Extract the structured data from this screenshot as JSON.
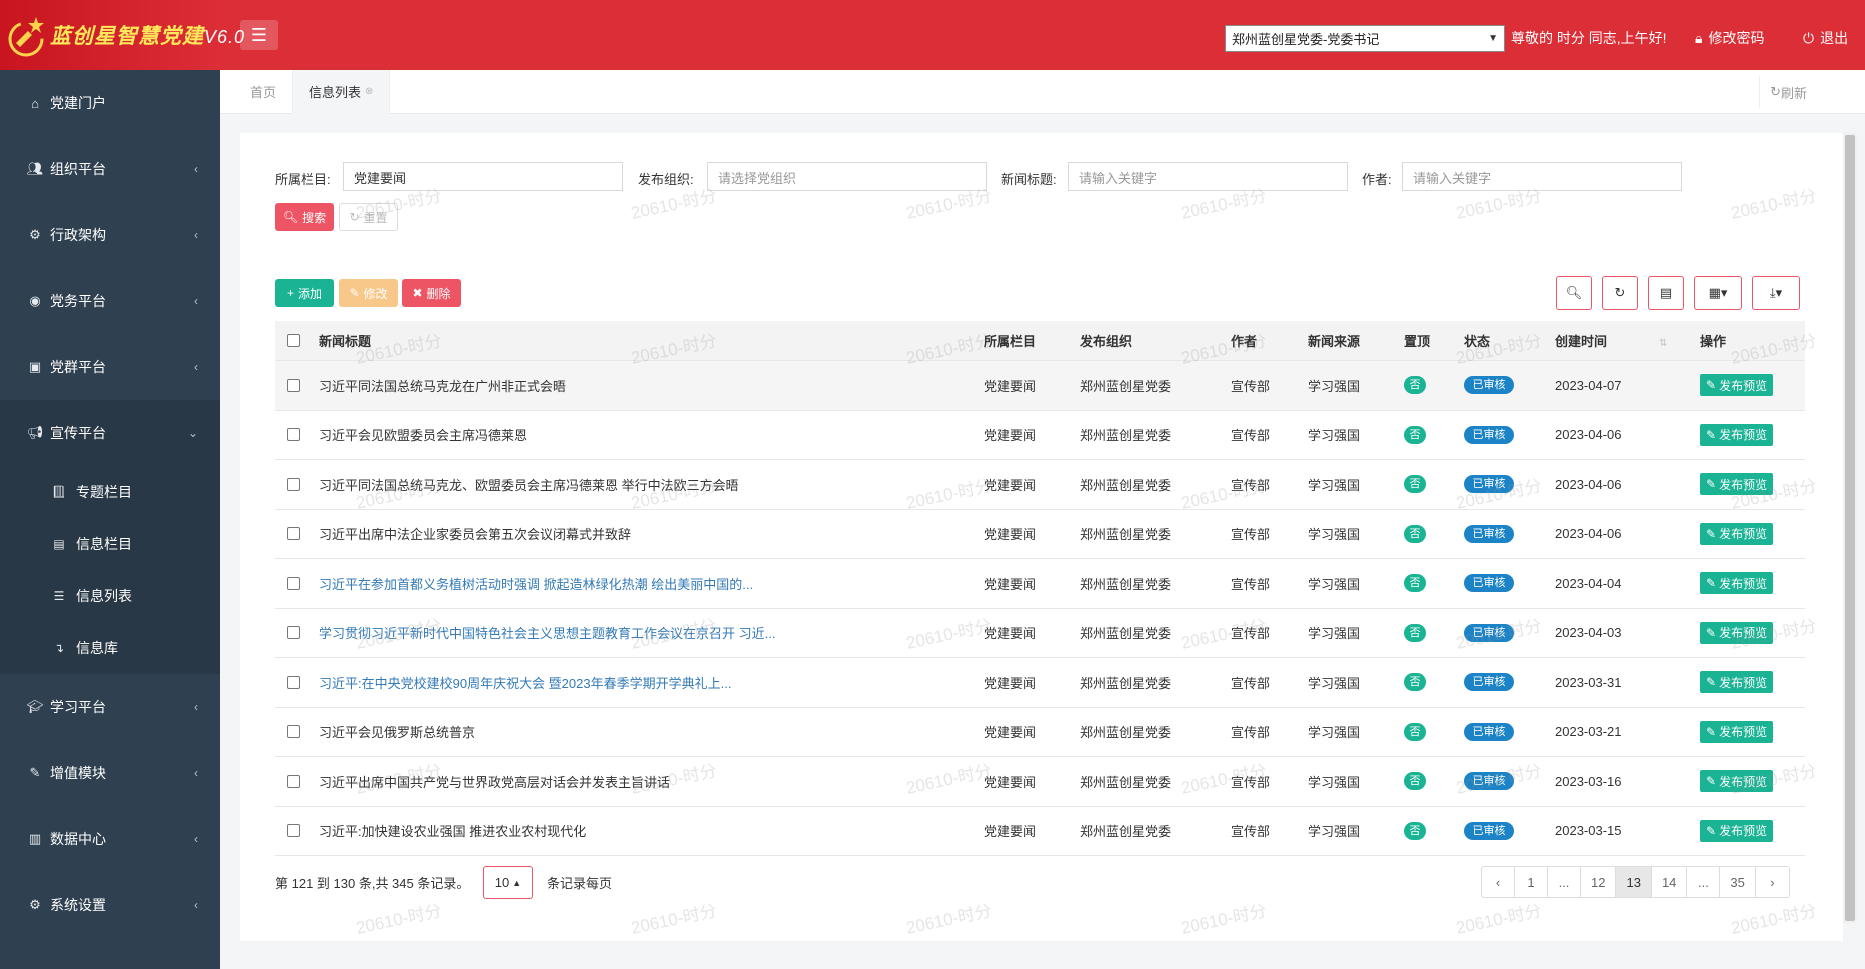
{
  "brand": {
    "title": "蓝创星智慧党建",
    "version": "V6.0"
  },
  "header": {
    "org_select_value": "郑州蓝创星党委-党委书记",
    "greeting": "尊敬的 时分 同志,上午好!",
    "change_password": "修改密码",
    "logout": "退出"
  },
  "sidebar": {
    "items": [
      {
        "label": "党建门户",
        "icon": "home-icon"
      },
      {
        "label": "组织平台",
        "icon": "users-icon"
      },
      {
        "label": "行政架构",
        "icon": "cogs-icon"
      },
      {
        "label": "党务平台",
        "icon": "eye-icon"
      },
      {
        "label": "党群平台",
        "icon": "id-card-icon"
      },
      {
        "label": "宣传平台",
        "icon": "bullhorn-icon"
      },
      {
        "label": "学习平台",
        "icon": "graduation-cap-icon"
      },
      {
        "label": "增值模块",
        "icon": "edit-icon"
      },
      {
        "label": "数据中心",
        "icon": "bar-chart-icon"
      },
      {
        "label": "系统设置",
        "icon": "gear-icon"
      }
    ],
    "sub_items": [
      {
        "label": "专题栏目",
        "icon": "book-icon"
      },
      {
        "label": "信息栏目",
        "icon": "newspaper-icon"
      },
      {
        "label": "信息列表",
        "icon": "list-icon"
      },
      {
        "label": "信息库",
        "icon": "level-down-icon"
      }
    ]
  },
  "tabs": {
    "home": "首页",
    "current": "信息列表",
    "refresh": "刷新"
  },
  "filters": {
    "column_label": "所属栏目:",
    "column_value": "党建要闻",
    "org_label": "发布组织:",
    "org_placeholder": "请选择党组织",
    "title_label": "新闻标题:",
    "title_placeholder": "请输入关键字",
    "author_label": "作者:",
    "author_placeholder": "请输入关键字",
    "search": "搜索",
    "reset": "重置"
  },
  "toolbar": {
    "add": "添加",
    "edit": "修改",
    "delete": "删除"
  },
  "table": {
    "headers": {
      "title": "新闻标题",
      "column": "所属栏目",
      "org": "发布组织",
      "author": "作者",
      "source": "新闻来源",
      "top": "置顶",
      "status": "状态",
      "created": "创建时间",
      "op": "操作"
    },
    "rows": [
      {
        "title": "习近平同法国总统马克龙在广州非正式会晤",
        "column": "党建要闻",
        "org": "郑州蓝创星党委",
        "author": "宣传部",
        "source": "学习强国",
        "top": "否",
        "status": "已审核",
        "created": "2023-04-07",
        "op": "发布预览",
        "link": false
      },
      {
        "title": "习近平会见欧盟委员会主席冯德莱恩",
        "column": "党建要闻",
        "org": "郑州蓝创星党委",
        "author": "宣传部",
        "source": "学习强国",
        "top": "否",
        "status": "已审核",
        "created": "2023-04-06",
        "op": "发布预览",
        "link": false
      },
      {
        "title": "习近平同法国总统马克龙、欧盟委员会主席冯德莱恩 举行中法欧三方会晤",
        "column": "党建要闻",
        "org": "郑州蓝创星党委",
        "author": "宣传部",
        "source": "学习强国",
        "top": "否",
        "status": "已审核",
        "created": "2023-04-06",
        "op": "发布预览",
        "link": false
      },
      {
        "title": "习近平出席中法企业家委员会第五次会议闭幕式并致辞",
        "column": "党建要闻",
        "org": "郑州蓝创星党委",
        "author": "宣传部",
        "source": "学习强国",
        "top": "否",
        "status": "已审核",
        "created": "2023-04-06",
        "op": "发布预览",
        "link": false
      },
      {
        "title": "习近平在参加首都义务植树活动时强调 掀起造林绿化热潮 绘出美丽中国的...",
        "column": "党建要闻",
        "org": "郑州蓝创星党委",
        "author": "宣传部",
        "source": "学习强国",
        "top": "否",
        "status": "已审核",
        "created": "2023-04-04",
        "op": "发布预览",
        "link": true
      },
      {
        "title": "学习贯彻习近平新时代中国特色社会主义思想主题教育工作会议在京召开 习近...",
        "column": "党建要闻",
        "org": "郑州蓝创星党委",
        "author": "宣传部",
        "source": "学习强国",
        "top": "否",
        "status": "已审核",
        "created": "2023-04-03",
        "op": "发布预览",
        "link": true
      },
      {
        "title": "习近平:在中央党校建校90周年庆祝大会 暨2023年春季学期开学典礼上...",
        "column": "党建要闻",
        "org": "郑州蓝创星党委",
        "author": "宣传部",
        "source": "学习强国",
        "top": "否",
        "status": "已审核",
        "created": "2023-03-31",
        "op": "发布预览",
        "link": true
      },
      {
        "title": "习近平会见俄罗斯总统普京",
        "column": "党建要闻",
        "org": "郑州蓝创星党委",
        "author": "宣传部",
        "source": "学习强国",
        "top": "否",
        "status": "已审核",
        "created": "2023-03-21",
        "op": "发布预览",
        "link": false
      },
      {
        "title": "习近平出席中国共产党与世界政党高层对话会并发表主旨讲话",
        "column": "党建要闻",
        "org": "郑州蓝创星党委",
        "author": "宣传部",
        "source": "学习强国",
        "top": "否",
        "status": "已审核",
        "created": "2023-03-16",
        "op": "发布预览",
        "link": false
      },
      {
        "title": "习近平:加快建设农业强国 推进农业农村现代化",
        "column": "党建要闻",
        "org": "郑州蓝创星党委",
        "author": "宣传部",
        "source": "学习强国",
        "top": "否",
        "status": "已审核",
        "created": "2023-03-15",
        "op": "发布预览",
        "link": false
      }
    ]
  },
  "pager": {
    "info": "第 121 到 130 条,共 345 条记录。",
    "page_size": "10",
    "tail": "条记录每页",
    "pages": [
      "‹",
      "1",
      "...",
      "12",
      "13",
      "14",
      "...",
      "35",
      "›"
    ],
    "active_page": "13"
  },
  "watermark": "20610-时分"
}
